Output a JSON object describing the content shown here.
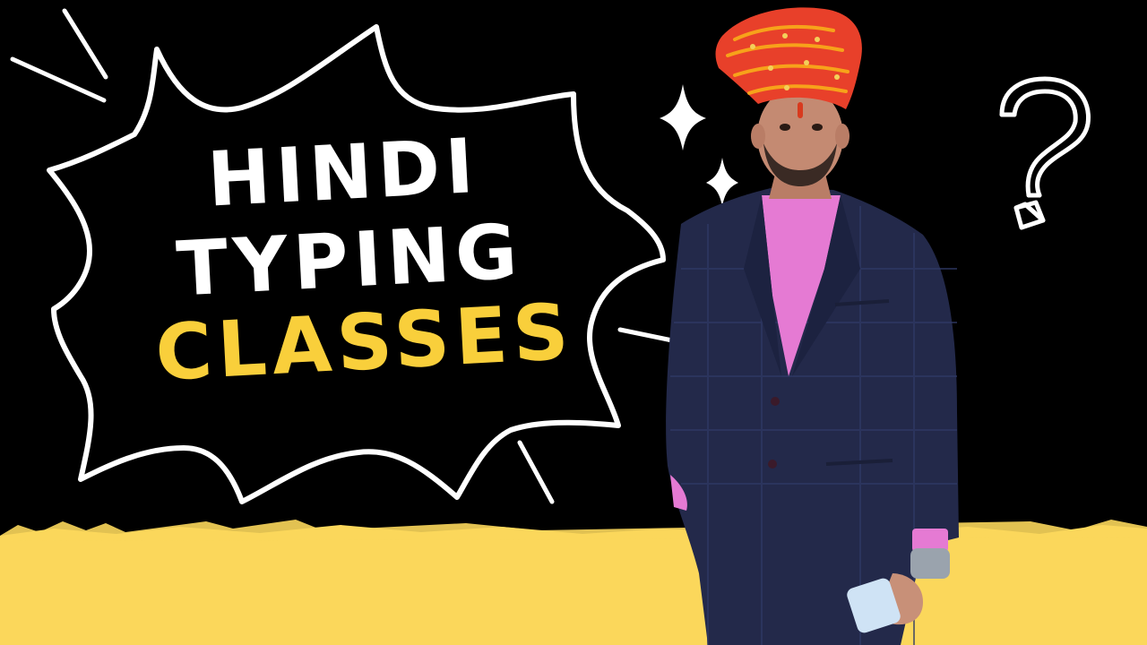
{
  "headline": {
    "line1": "HINDI",
    "line2": "TYPING",
    "line3": "CLASSES"
  },
  "colors": {
    "background": "#000000",
    "accent_yellow": "#f9cf3b",
    "text_white": "#ffffff",
    "turban": "#e8402a",
    "shirt": "#e57ad3",
    "suit": "#23294a"
  },
  "icons": [
    "sparkle-icon",
    "question-mark-icon",
    "speech-burst-outline"
  ]
}
